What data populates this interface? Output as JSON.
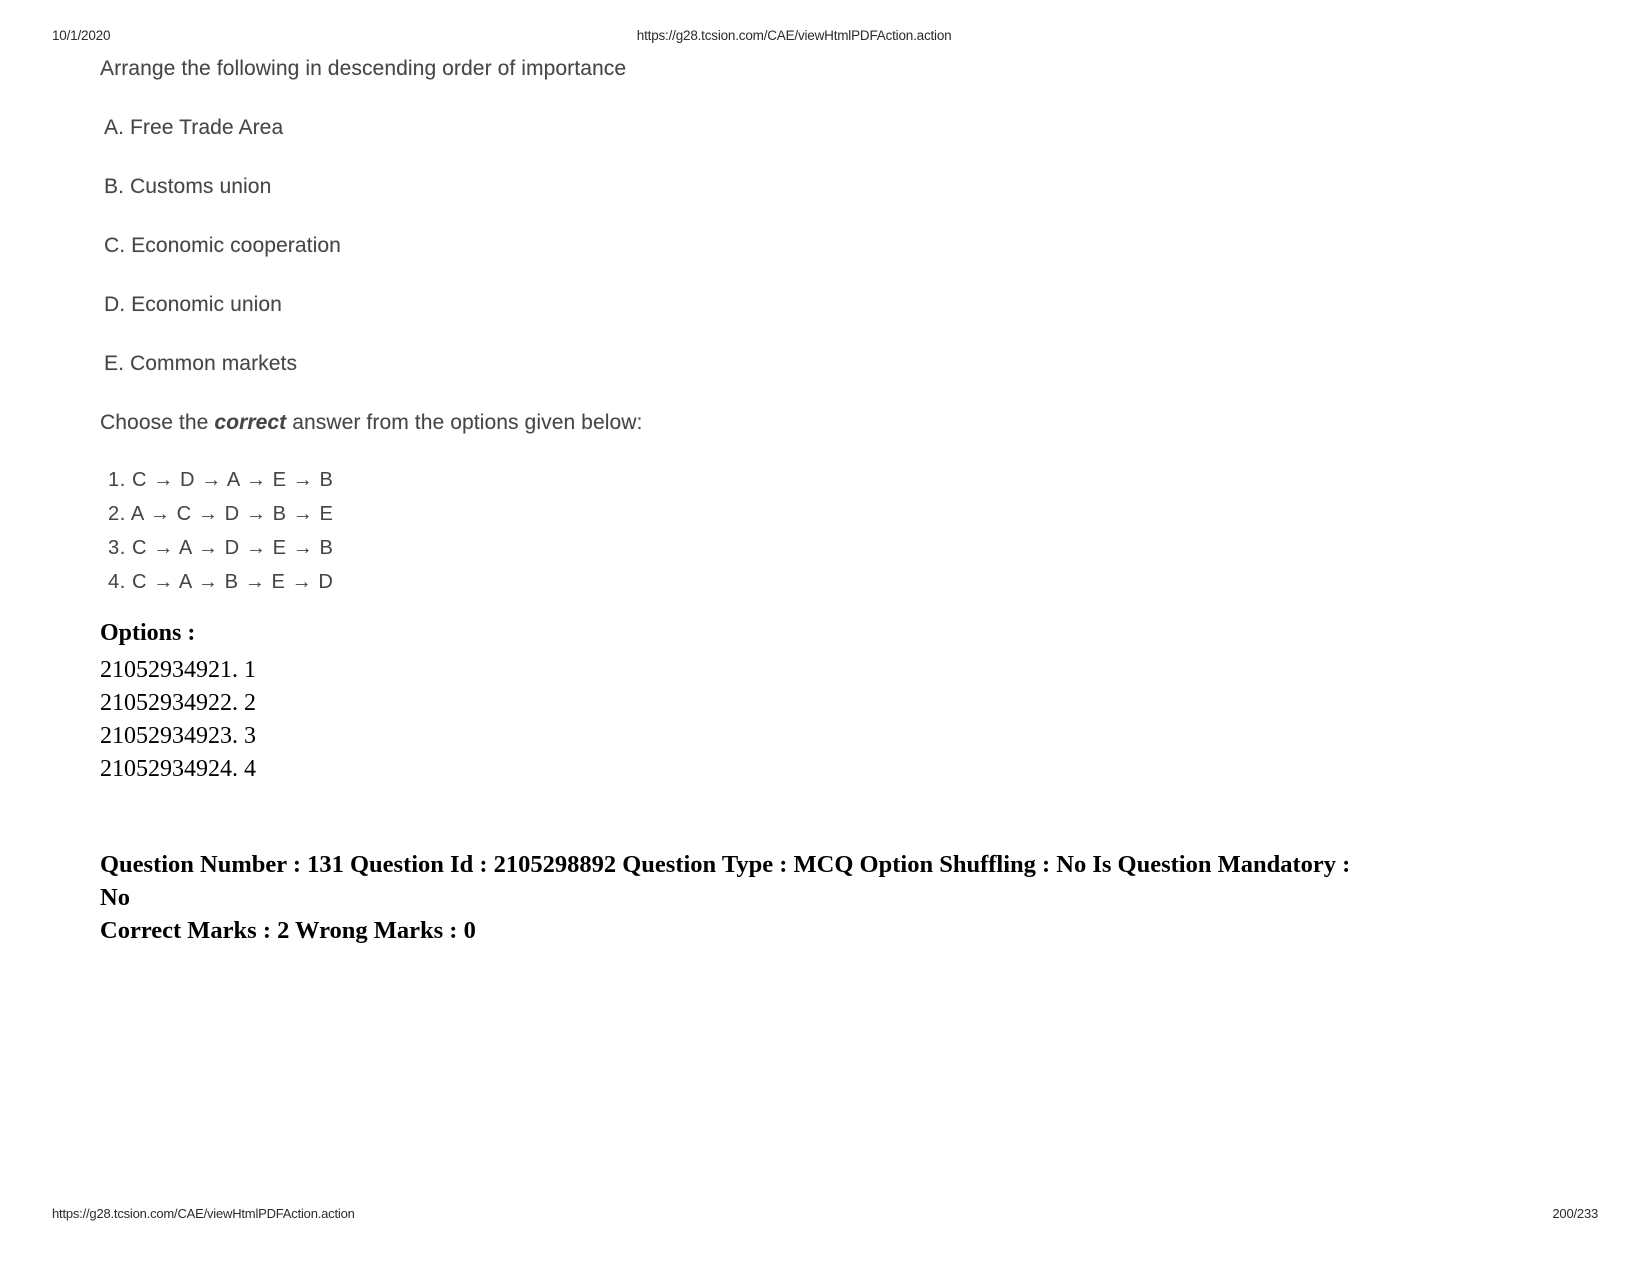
{
  "header": {
    "date": "10/1/2020",
    "url": "https://g28.tcsion.com/CAE/viewHtmlPDFAction.action"
  },
  "footer": {
    "url": "https://g28.tcsion.com/CAE/viewHtmlPDFAction.action",
    "page": "200/233"
  },
  "question": {
    "stem": "Arrange the following in descending order of importance",
    "items": [
      "A. Free Trade Area",
      "B. Customs union",
      "C. Economic cooperation",
      "D. Economic union",
      "E. Common markets"
    ],
    "choose_prefix": "Choose the ",
    "choose_emphasis": "correct",
    "choose_suffix": " answer from the options given below:",
    "sequences": [
      "1. C → D → A → E → B",
      "2. A → C → D → B → E",
      "3. C → A → D → E → B",
      "4. C → A → B → E → D"
    ]
  },
  "options": {
    "label": "Options :",
    "rows": [
      "21052934921. 1",
      "21052934922. 2",
      "21052934923. 3",
      "21052934924. 4"
    ]
  },
  "meta": {
    "line1": "Question Number : 131 Question Id : 2105298892 Question Type : MCQ Option Shuffling : No Is Question Mandatory : No",
    "line2": "Correct Marks : 2 Wrong Marks : 0"
  }
}
